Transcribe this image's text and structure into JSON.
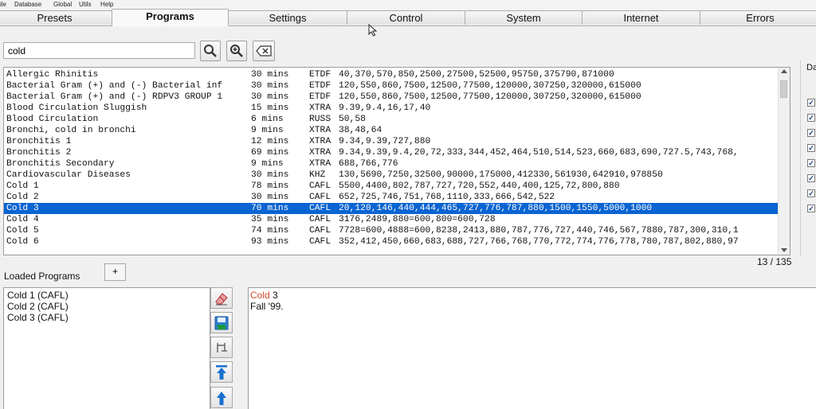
{
  "menu": [
    "ile",
    "Database",
    "Global",
    "Utils",
    "Help"
  ],
  "tabs": [
    "Presets",
    "Programs",
    "Settings",
    "Control",
    "System",
    "Internet",
    "Errors"
  ],
  "active_tab": "Programs",
  "search": {
    "value": "cold"
  },
  "right_panel": {
    "label": "Da"
  },
  "programs": [
    {
      "name": "Allergic Rhinitis",
      "duration": "30 mins",
      "type": "ETDF",
      "freqs": "40,370,570,850,2500,27500,52500,95750,375790,871000"
    },
    {
      "name": "Bacterial Gram (+) and (-) Bacterial inf",
      "duration": "30 mins",
      "type": "ETDF",
      "freqs": "120,550,860,7500,12500,77500,120000,307250,320000,615000"
    },
    {
      "name": "Bacterial Gram (+) and (-) RDPV3 GROUP 1",
      "duration": "30 mins",
      "type": "ETDF",
      "freqs": "120,550,860,7500,12500,77500,120000,307250,320000,615000"
    },
    {
      "name": "Blood Circulation Sluggish",
      "duration": "15 mins",
      "type": "XTRA",
      "freqs": "9.39,9.4,16,17,40"
    },
    {
      "name": "Blood Circulation",
      "duration": "6 mins",
      "type": "RUSS",
      "freqs": "50,58"
    },
    {
      "name": "Bronchi, cold in bronchi",
      "duration": "9 mins",
      "type": "XTRA",
      "freqs": "38,48,64"
    },
    {
      "name": "Bronchitis 1",
      "duration": "12 mins",
      "type": "XTRA",
      "freqs": "9.34,9.39,727,880"
    },
    {
      "name": "Bronchitis 2",
      "duration": "69 mins",
      "type": "XTRA",
      "freqs": "9.34,9.39,9.4,20,72,333,344,452,464,510,514,523,660,683,690,727.5,743,768,"
    },
    {
      "name": "Bronchitis Secondary",
      "duration": "9 mins",
      "type": "XTRA",
      "freqs": "688,766,776"
    },
    {
      "name": "Cardiovascular Diseases",
      "duration": "30 mins",
      "type": "KHZ",
      "freqs": "130,5690,7250,32500,90000,175000,412330,561930,642910,978850"
    },
    {
      "name": "Cold 1",
      "duration": "78 mins",
      "type": "CAFL",
      "freqs": "5500,4400,802,787,727,720,552,440,400,125,72,800,880"
    },
    {
      "name": "Cold 2",
      "duration": "30 mins",
      "type": "CAFL",
      "freqs": "652,725,746,751,768,1110,333,666,542,522"
    },
    {
      "name": "Cold 3",
      "duration": "70 mins",
      "type": "CAFL",
      "freqs": "20,120,146,440,444,465,727,776,787,880,1500,1550,5000,1000"
    },
    {
      "name": "Cold 4",
      "duration": "35 mins",
      "type": "CAFL",
      "freqs": "3176,2489,880=600,800=600,728"
    },
    {
      "name": "Cold 5",
      "duration": "74 mins",
      "type": "CAFL",
      "freqs": "7728=600,4888=600,8238,2413,880,787,776,727,440,746,567,7880,787,300,310,1"
    },
    {
      "name": "Cold 6",
      "duration": "93 mins",
      "type": "CAFL",
      "freqs": "352,412,450,660,683,688,727,766,768,770,772,774,776,778,780,787,802,880,97"
    }
  ],
  "selected_index": 12,
  "count": "13 / 135",
  "loaded": {
    "title": "Loaded Programs",
    "add_label": "+",
    "items": [
      "Cold 1 (CAFL)",
      "Cold 2 (CAFL)",
      "Cold 3 (CAFL)"
    ]
  },
  "description": {
    "title_red": "Cold",
    "title_rest": " 3",
    "source": "Fall '99."
  }
}
